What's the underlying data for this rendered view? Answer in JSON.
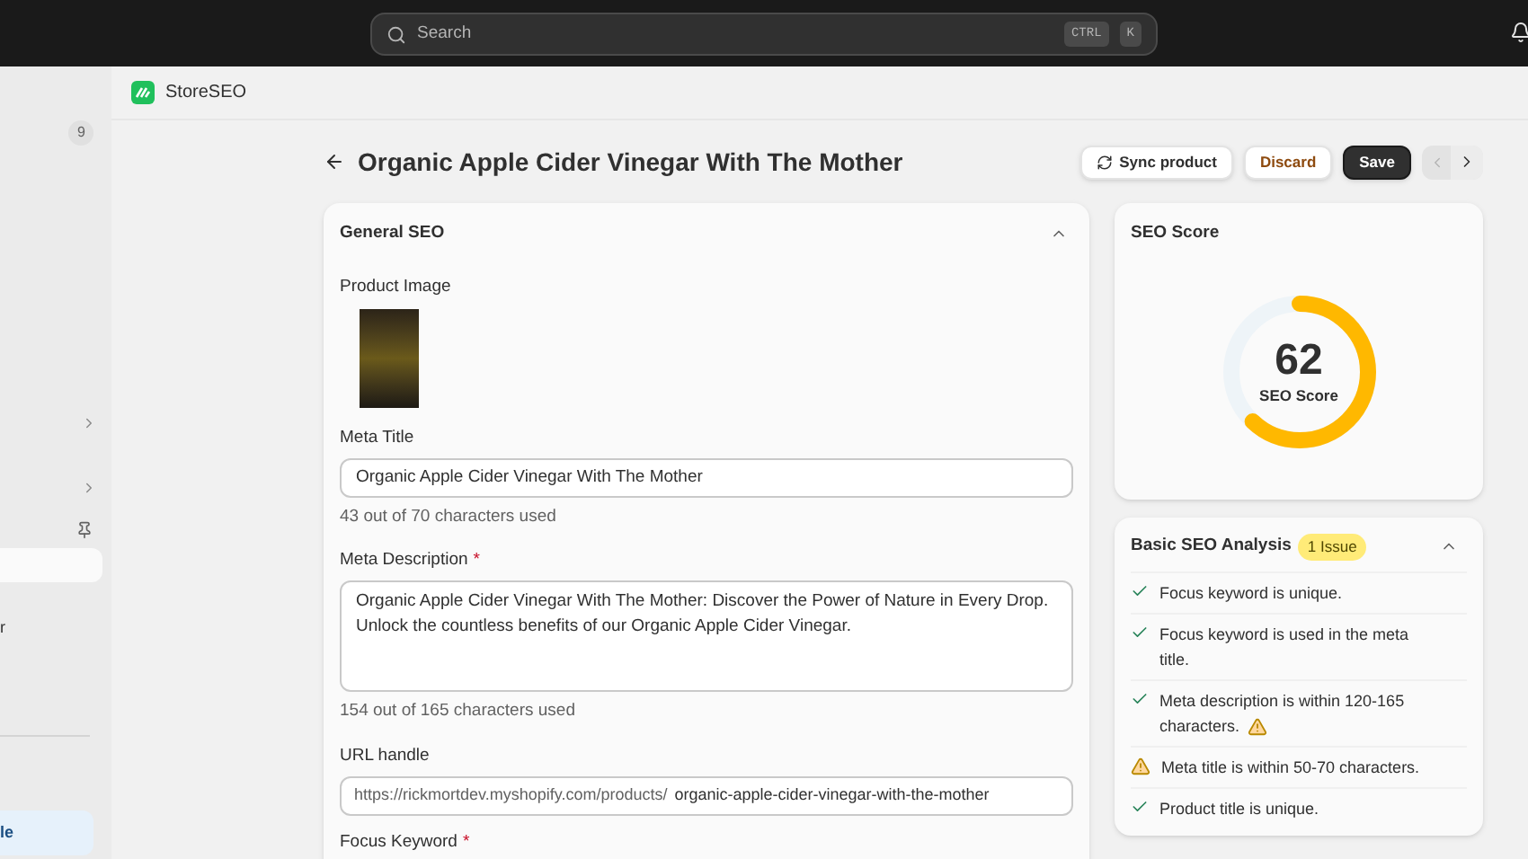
{
  "topbar": {
    "search_placeholder": "Search",
    "shortcut_keys": [
      "CTRL",
      "K"
    ]
  },
  "sidebar": {
    "badge": "9",
    "items": [
      {
        "label": "r",
        "selected": false
      },
      {
        "label": "le",
        "selected": true
      }
    ]
  },
  "app": {
    "name": "StoreSEO"
  },
  "page": {
    "title": "Organic Apple Cider Vinegar With The Mother",
    "buttons": [
      {
        "label": "Sync product",
        "kind": "sync"
      },
      {
        "label": "Discard",
        "kind": "discard"
      },
      {
        "label": "Save",
        "kind": "primary"
      }
    ],
    "pager": {
      "previous_disabled": true,
      "next_disabled": false
    }
  },
  "general_seo": {
    "title": "General SEO",
    "expanded": true,
    "product_image_label": "Product Image",
    "meta_title": {
      "label": "Meta Title",
      "value": "Organic Apple Cider Vinegar With The Mother",
      "counter": "43 out of 70 characters used"
    },
    "meta_description": {
      "label": "Meta Description",
      "required_mark": "*",
      "value": "Organic Apple Cider Vinegar With The Mother: Discover the Power of Nature in Every Drop. Unlock the countless benefits of our Organic Apple Cider Vinegar.",
      "counter": "154 out of 165 characters used"
    },
    "url_handle": {
      "label": "URL handle",
      "prefix": "https://rickmortdev.myshopify.com/products/",
      "value": "organic-apple-cider-vinegar-with-the-mother"
    },
    "focus_keyword": {
      "label": "Focus Keyword",
      "required_mark": "*"
    }
  },
  "seo_score": {
    "title": "SEO Score",
    "score": "62",
    "caption": "SEO Score",
    "level": 0.62
  },
  "analysis": {
    "title": "Basic SEO Analysis",
    "badge": "1 Issue",
    "expanded": true,
    "items": [
      {
        "text": "Focus keyword is unique.",
        "kind": "pass",
        "trailing_warning": false
      },
      {
        "text": "Focus keyword is used in the meta title.",
        "kind": "pass",
        "trailing_warning": false
      },
      {
        "text": "Meta description is within 120-165 characters.",
        "kind": "pass",
        "trailing_warning": true
      },
      {
        "text": "Meta title is within 50-70 characters.",
        "kind": "warning",
        "trailing_warning": false
      },
      {
        "text": "Product title is unique.",
        "kind": "pass",
        "trailing_warning": false
      }
    ]
  }
}
